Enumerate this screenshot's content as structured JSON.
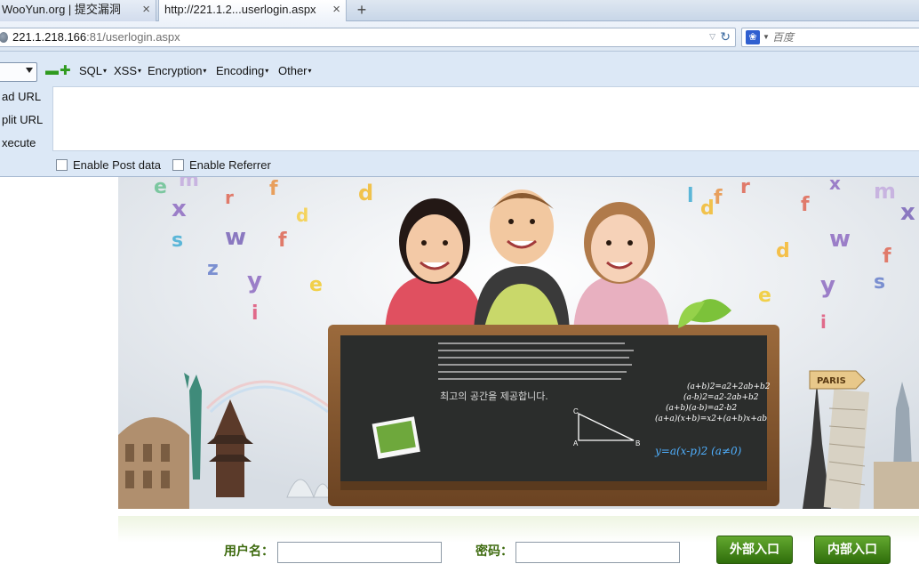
{
  "browser": {
    "tabs": [
      {
        "label": "WooYun.org | 提交漏洞",
        "active": false
      },
      {
        "label": "http://221.1.2...userlogin.aspx",
        "active": true
      }
    ],
    "new_tab_symbol": "+",
    "tab_close_symbol": "×",
    "url_host": "221.1.218.166",
    "url_path": ":81/userlogin.aspx",
    "search_placeholder": "百度",
    "search_engine_icon": "baidu-paw-icon"
  },
  "hackbar": {
    "menus": [
      "SQL",
      "XSS",
      "Encryption",
      "Encoding",
      "Other"
    ],
    "side_actions": [
      "ad URL",
      "plit URL",
      "xecute"
    ],
    "checkboxes": [
      {
        "label": "Enable Post data",
        "checked": false
      },
      {
        "label": "Enable Referrer",
        "checked": false
      }
    ]
  },
  "banner": {
    "chalk_text": "최고의 공간을 제공합니다.",
    "formulas": [
      "(a+b)2=a2+2ab+b2",
      "(a-b)2=a2-2ab+b2",
      "(a+b)(a-b)=a2-b2",
      "(a+a)(x+b)=x2+(a+b)x+ab"
    ],
    "blue_formula": "y=a(x-p)2   (a≠0)",
    "sign_text": "PARIS",
    "triangle_labels": [
      "C",
      "A",
      "B"
    ]
  },
  "login": {
    "username_label": "用户名：",
    "password_label": "密码：",
    "external_button": "外部入口",
    "internal_button": "内部入口"
  },
  "colors": {
    "login_label": "#3d6a0e",
    "button_green": "#2f6e0b",
    "hackbar_bg": "#dce8f6"
  }
}
